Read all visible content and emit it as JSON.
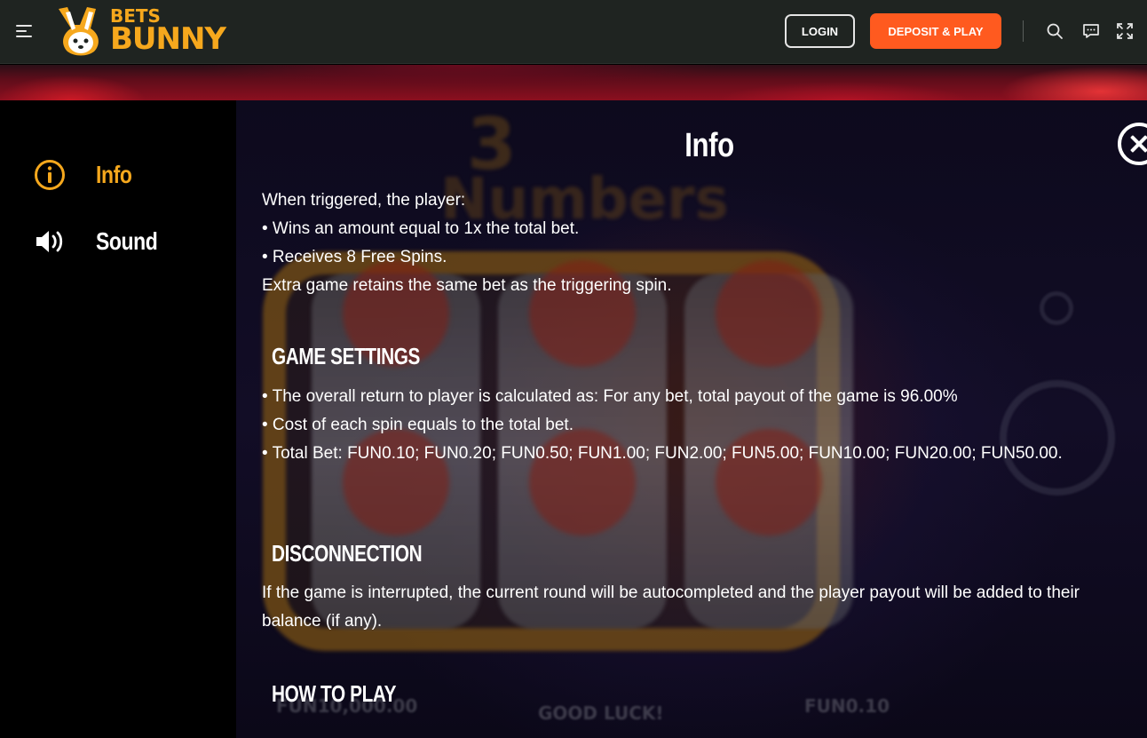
{
  "header": {
    "logo": {
      "top": "BETS",
      "bottom": "BUNNY"
    },
    "login_label": "LOGIN",
    "deposit_label": "DEPOSIT & PLAY",
    "icons": [
      "menu-icon",
      "search-icon",
      "chat-icon",
      "fullscreen-icon"
    ],
    "colors": {
      "accent": "#f6a81d",
      "cta": "#ff5a1f",
      "bar": "#1f2421"
    }
  },
  "sidebar": {
    "items": [
      {
        "label": "Info",
        "icon": "info-icon",
        "active": true
      },
      {
        "label": "Sound",
        "icon": "speaker-icon",
        "active": false
      }
    ]
  },
  "panel": {
    "title": "Info",
    "intro_lines": [
      "When triggered, the player:",
      "• Wins an amount equal to 1x the total bet.",
      "• Receives 8 Free Spins.",
      "Extra game retains the same bet as the triggering spin."
    ],
    "game_settings": {
      "heading": "GAME SETTINGS",
      "lines": [
        "• The overall return to player is calculated as: For any bet, total payout of the game is 96.00%",
        "• Cost of each spin equals to the total bet.",
        "• Total Bet: FUN0.10; FUN0.20; FUN0.50; FUN1.00; FUN2.00; FUN5.00; FUN10.00; FUN20.00; FUN50.00."
      ]
    },
    "disconnection": {
      "heading": "DISCONNECTION",
      "text": "If the game is interrupted, the current round will be autocompleted and the player payout will be added to their balance (if any)."
    },
    "how_to_play": {
      "heading": "HOW TO PLAY"
    }
  },
  "game_background": {
    "title_a": "3",
    "title_b": "Numbers",
    "bottom_balance": "FUN10,000.00",
    "bottom_message": "GOOD LUCK!",
    "bottom_bet": "FUN0.10"
  }
}
